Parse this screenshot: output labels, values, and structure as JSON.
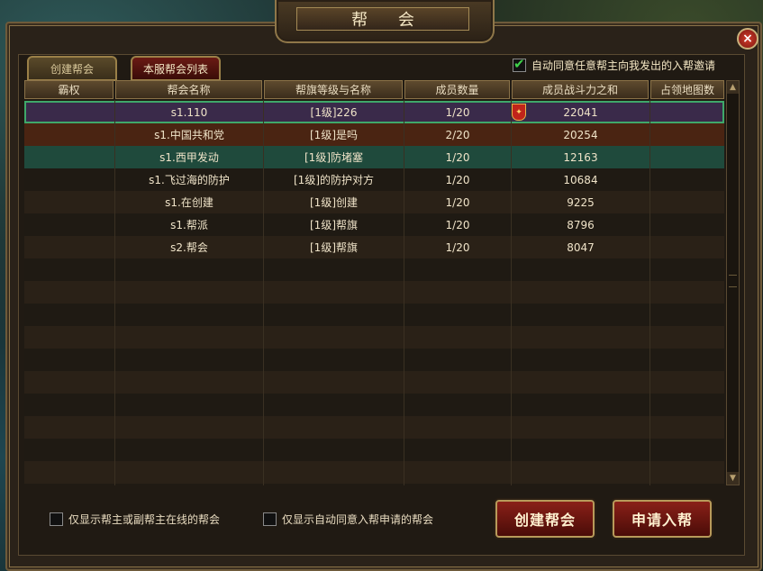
{
  "window": {
    "title": "帮 会",
    "close_glyph": "×"
  },
  "tabs": [
    {
      "label": "创建帮会"
    },
    {
      "label": "本服帮会列表"
    }
  ],
  "auto_accept": {
    "label": "自动同意任意帮主向我发出的入帮邀请",
    "checked": true
  },
  "table": {
    "headers": [
      "霸权",
      "帮会名称",
      "帮旗等级与名称",
      "成员数量",
      "成员战斗力之和",
      "占领地图数"
    ],
    "rows": [
      {
        "hegemony": "",
        "name": "s1.110",
        "flag": "[1级]226",
        "members": "1/20",
        "power": "22041",
        "maps": "",
        "crest": true
      },
      {
        "hegemony": "",
        "name": "s1.中国共和党",
        "flag": "[1级]是吗",
        "members": "2/20",
        "power": "20254",
        "maps": ""
      },
      {
        "hegemony": "",
        "name": "s1.西甲发动",
        "flag": "[1级]防堵塞",
        "members": "1/20",
        "power": "12163",
        "maps": ""
      },
      {
        "hegemony": "",
        "name": "s1.飞过海的防护",
        "flag": "[1级]的防护对方",
        "members": "1/20",
        "power": "10684",
        "maps": ""
      },
      {
        "hegemony": "",
        "name": "s1.在创建",
        "flag": "[1级]创建",
        "members": "1/20",
        "power": "9225",
        "maps": ""
      },
      {
        "hegemony": "",
        "name": "s1.帮派",
        "flag": "[1级]帮旗",
        "members": "1/20",
        "power": "8796",
        "maps": ""
      },
      {
        "hegemony": "",
        "name": "s2.帮会",
        "flag": "[1级]帮旗",
        "members": "1/20",
        "power": "8047",
        "maps": ""
      }
    ]
  },
  "filters": [
    {
      "label": "仅显示帮主或副帮主在线的帮会",
      "checked": false
    },
    {
      "label": "仅显示自动同意入帮申请的帮会",
      "checked": false
    }
  ],
  "buttons": {
    "create": "创建帮会",
    "apply": "申请入帮"
  },
  "icons": {
    "close": "close-icon",
    "crest": "guild-crest-icon",
    "scroll_up": "scroll-up-icon",
    "scroll_down": "scroll-down-icon"
  }
}
